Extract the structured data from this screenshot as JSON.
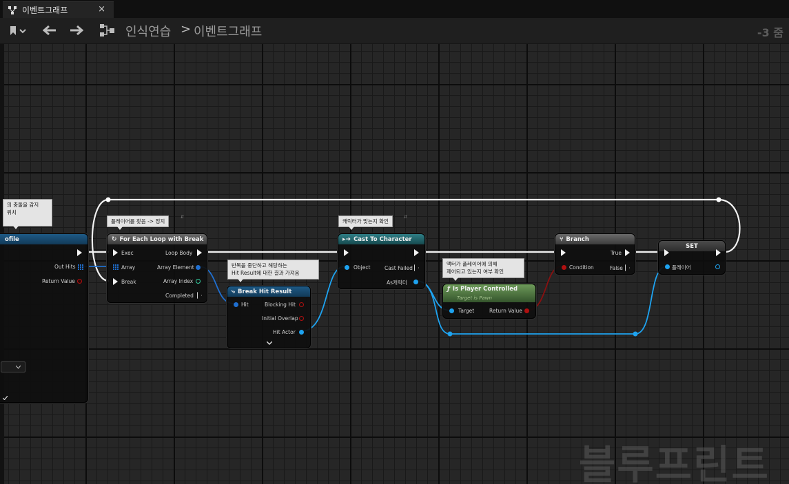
{
  "tab": {
    "label": "이벤트그래프",
    "close": "×"
  },
  "toolbar": {
    "path_root": "인식연습",
    "separator": ">",
    "path_leaf": "이벤트그래프",
    "zoom": "-3 줌"
  },
  "watermark": "블루프린트",
  "partial": {
    "comment": [
      "의 충돌을 감지",
      "위치"
    ],
    "title": "ofile",
    "out_hits": "Out Hits",
    "return_value": "Return Value"
  },
  "comments": {
    "foreach": "플레이어를 찾음 -> 정지",
    "breakhit": [
      "반복을 중단하고 해당하는",
      "Hit Result에 대한 결과 가져옴"
    ],
    "cast": "캐릭터가 맞는지 확인",
    "isplayer": [
      "액터가 플레이어에 의해",
      "제어되고 있는지 여부 확인"
    ]
  },
  "nodes": {
    "foreach": {
      "title": "For Each Loop with Break",
      "exec": "Exec",
      "array": "Array",
      "break": "Break",
      "loop_body": "Loop Body",
      "array_element": "Array Element",
      "array_index": "Array Index",
      "completed": "Completed"
    },
    "breakhit": {
      "title": "Break Hit Result",
      "hit": "Hit",
      "blocking_hit": "Blocking Hit",
      "initial_overlap": "Initial Overlap",
      "hit_actor": "Hit Actor"
    },
    "cast": {
      "title": "Cast To Character",
      "object": "Object",
      "cast_failed": "Cast Failed",
      "as_character": "As캐릭터"
    },
    "isplayer": {
      "title": "Is Player Controlled",
      "subtitle": "Target is Pawn",
      "target": "Target",
      "return_value": "Return Value"
    },
    "branch": {
      "title": "Branch",
      "condition": "Condition",
      "true_label": "True",
      "false_label": "False"
    },
    "set": {
      "title": "SET",
      "var": "플레이어"
    }
  },
  "colors": {
    "exec": "#f2f2f2",
    "object": "#1ea3f0",
    "bool": "#b01010",
    "struct": "#1f6fd0",
    "int": "#35d2a4"
  }
}
